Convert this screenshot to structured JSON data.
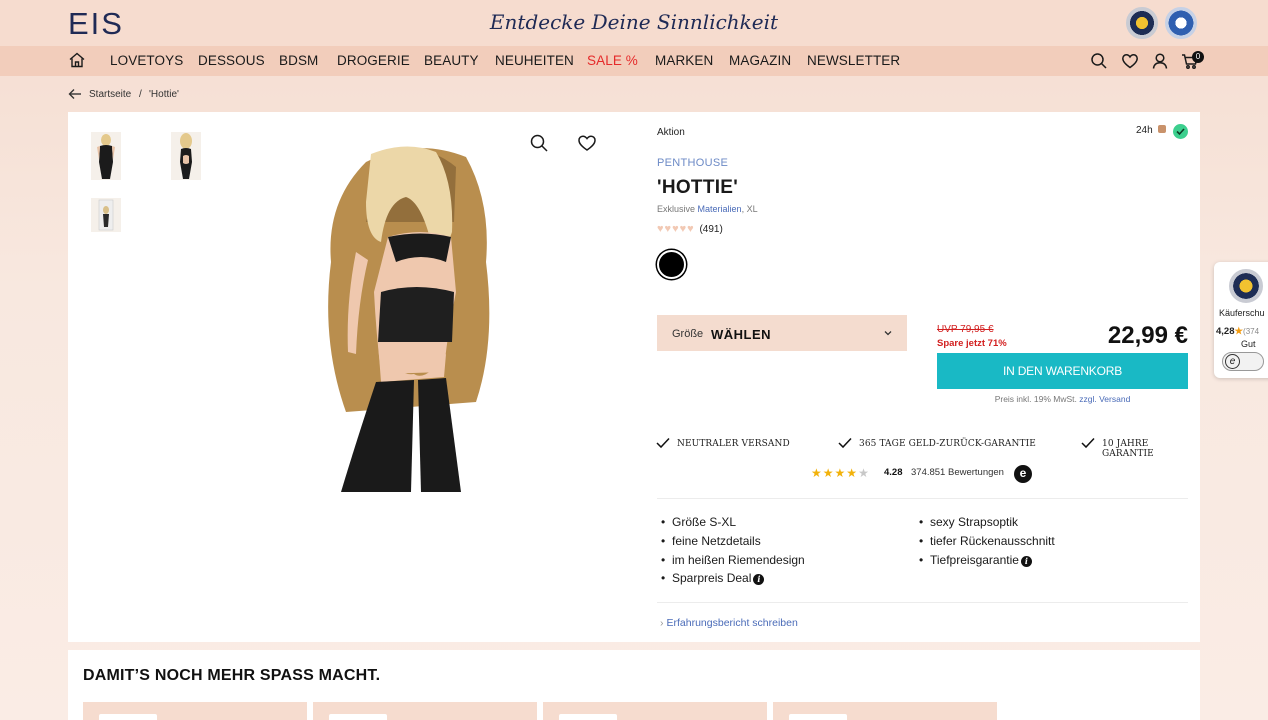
{
  "header": {
    "logo": "EIS",
    "slogan": "Entdecke Deine Sinnlichkeit",
    "cart_count": "0"
  },
  "nav": {
    "items": [
      "LOVETOYS",
      "DESSOUS",
      "BDSM",
      "DROGERIE",
      "BEAUTY",
      "NEUHEITEN",
      "SALE %",
      "MARKEN",
      "MAGAZIN",
      "NEWSLETTER"
    ]
  },
  "breadcrumb": {
    "home": "Startseite",
    "separator": "/",
    "current": "'Hottie'"
  },
  "product": {
    "tag": "Aktion",
    "delivery_badge": "24h",
    "brand": "PENTHOUSE",
    "title": "'HOTTIE'",
    "subtitle_prefix": "Exklusive",
    "subtitle_link": "Materialien",
    "subtitle_suffix": ", XL",
    "rating_count": "(491)",
    "rating_value": 0,
    "size_label": "Größe",
    "size_value": "WÄHLEN",
    "uvp": "UVP 79,95 €",
    "savings": "Spare jetzt 71%",
    "price": "22,99 €",
    "cart_button": "IN DEN WARENKORB",
    "price_note_prefix": "Preis inkl. 19% MwSt.",
    "price_note_link": "zzgl. Versand",
    "accent_color": "#19b9c5",
    "sale_color": "#d21f1f"
  },
  "usps": [
    "NEUTRALER VERSAND",
    "365 TAGE GELD-ZURÜCK-GARANTIE",
    "10 JAHRE GARANTIE"
  ],
  "trust_rating": {
    "stars": 4.28,
    "score": "4.28",
    "reviews": "374.851 Bewertungen"
  },
  "features_left": [
    "Größe S-XL",
    "feine Netzdetails",
    "im heißen Riemendesign",
    "Sparpreis Deal"
  ],
  "features_right": [
    "sexy Strapsoptik",
    "tiefer Rückenausschnitt",
    "Tiefpreisgarantie"
  ],
  "review_link": "Erfahrungsbericht schreiben",
  "side_widget": {
    "label": "Käuferschu",
    "score": "4,28",
    "count": "(374",
    "verdict": "Gut"
  },
  "more_section": {
    "title": "DAMIT’S NOCH MEHR SPASS MACHT."
  }
}
